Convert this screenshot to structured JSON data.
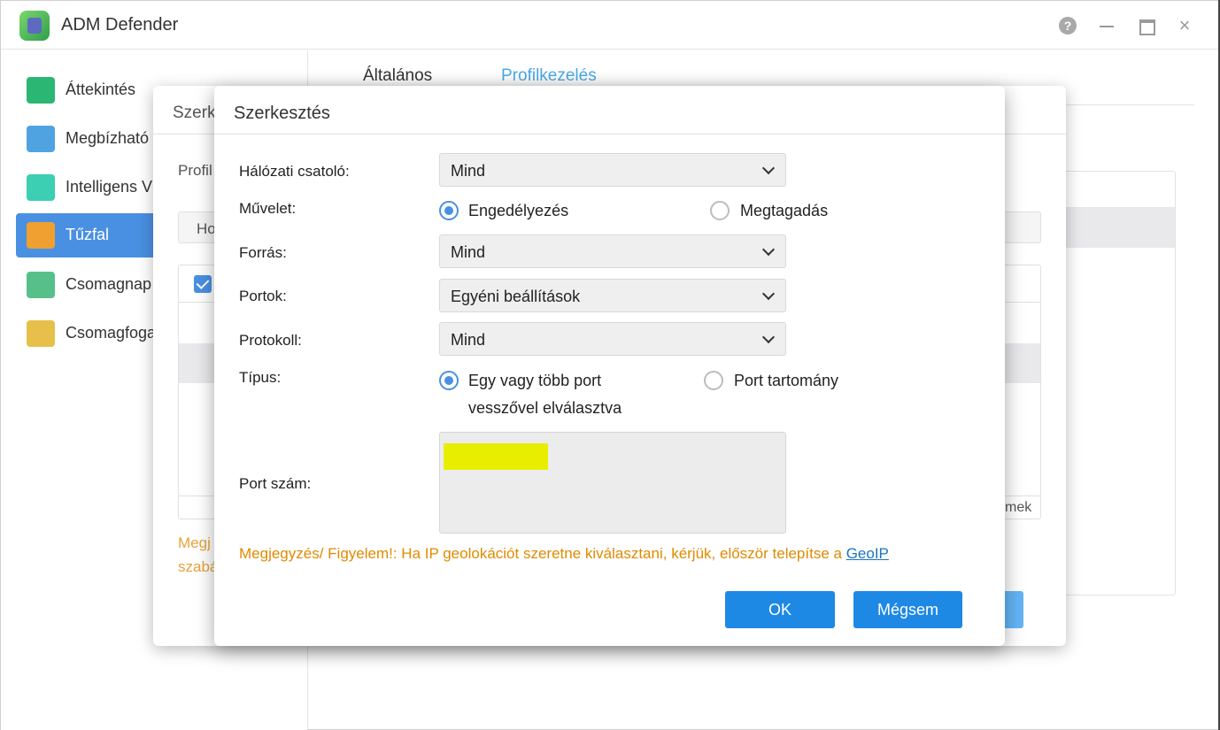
{
  "app": {
    "title": "ADM Defender",
    "help_icon": "?",
    "close_icon": "×"
  },
  "sidebar": {
    "items": [
      {
        "label": "Áttekintés",
        "icon": "overview-icon",
        "color": "#2bb673"
      },
      {
        "label": "Megbízható",
        "icon": "trust-list-icon",
        "color": "#4fa3e0"
      },
      {
        "label": "Intelligens V",
        "icon": "shield-bulb-icon",
        "color": "#3ccfb4"
      },
      {
        "label": "Tűzfal",
        "icon": "firewall-icon",
        "color": "#f0a030"
      },
      {
        "label": "Csomagnap",
        "icon": "package-log-icon",
        "color": "#57c08a"
      },
      {
        "label": "Csomagfoga",
        "icon": "packet-capture-icon",
        "color": "#e6c04a"
      }
    ]
  },
  "tabs": [
    "Általános",
    "Profilkezelés"
  ],
  "back_dialog": {
    "title": "Szerk",
    "profile_label": "Profil",
    "input_text": "Ho",
    "footer_text": "mek",
    "note_line1": "Megj",
    "note_line2": "szabá"
  },
  "dialog": {
    "title": "Szerkesztés",
    "fields": {
      "interface": {
        "label": "Hálózati csatoló:",
        "value": "Mind"
      },
      "action": {
        "label": "Művelet:",
        "option_allow": "Engedélyezés",
        "option_deny": "Megtagadás",
        "selected": "Engedélyezés"
      },
      "source": {
        "label": "Forrás:",
        "value": "Mind"
      },
      "ports": {
        "label": "Portok:",
        "value": "Egyéni beállítások"
      },
      "protocol": {
        "label": "Protokoll:",
        "value": "Mind"
      },
      "type": {
        "label": "Típus:",
        "option_multi_line1": "Egy vagy több port",
        "option_multi_line2": "vesszővel elválasztva",
        "option_range": "Port tartomány",
        "selected": "Egy vagy több port vesszővel elválasztva"
      },
      "port_number": {
        "label": "Port szám:"
      }
    },
    "note": "Megjegyzés/ Figyelem!: Ha IP geolokációt szeretne kiválasztani, kérjük, először telepítse a ",
    "note_link": "GeoIP ",
    "ok_label": "OK",
    "cancel_label": "Mégsem"
  },
  "colors": {
    "accent": "#1e88e5",
    "active_sidebar": "#4a90e2",
    "active_tab": "#4aa8e8",
    "warning_text": "#e08a00",
    "highlight": "#e8ee00"
  }
}
